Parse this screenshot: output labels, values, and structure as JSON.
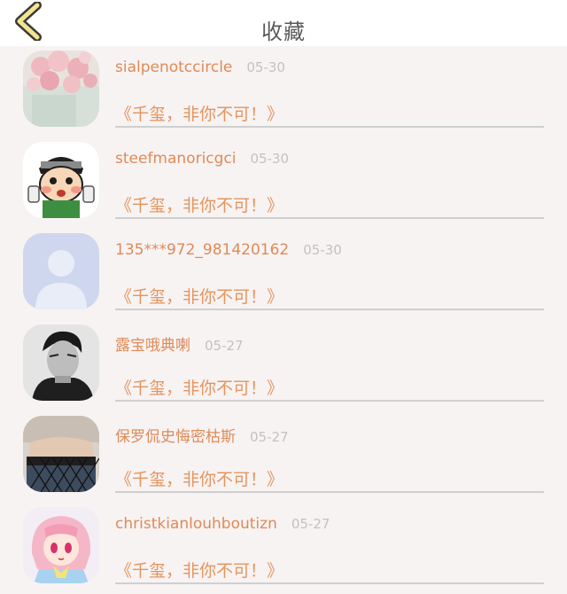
{
  "header": {
    "title": "收藏",
    "back_icon": "chevron-left-icon",
    "accent_color": "#f3e58e"
  },
  "items": [
    {
      "username": "sialpenotccircle",
      "date": "05-30",
      "message": "《千玺，非你不可！》",
      "avatar": "flowers-photo"
    },
    {
      "username": "steefmanoricgci",
      "date": "05-30",
      "message": "《千玺，非你不可！》",
      "avatar": "cartoon-character"
    },
    {
      "username": "135***972_981420162",
      "date": "05-30",
      "message": "《千玺，非你不可！》",
      "avatar": "default-user-silhouette"
    },
    {
      "username": "露宝哦典喇",
      "date": "05-27",
      "message": "《千玺，非你不可！》",
      "avatar": "man-portrait-bw"
    },
    {
      "username": "保罗侃史悔密枯斯",
      "date": "05-27",
      "message": "《千玺，非你不可！》",
      "avatar": "fishnet-photo"
    },
    {
      "username": "christkianlouhboutizn",
      "date": "05-27",
      "message": "《千玺，非你不可！》",
      "avatar": "anime-girl"
    }
  ]
}
